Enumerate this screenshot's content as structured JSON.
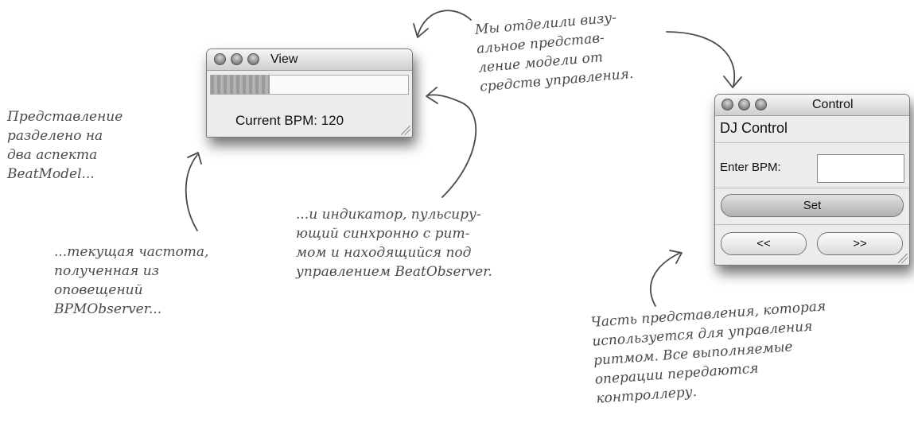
{
  "view_window": {
    "title": "View",
    "bpm_label": "Current BPM: 120",
    "pulse_level": 0.3
  },
  "control_window": {
    "title": "Control",
    "heading": "DJ Control",
    "enter_bpm_label": "Enter BPM:",
    "bpm_input_value": "",
    "set_label": "Set",
    "decrease_label": "<<",
    "increase_label": ">>"
  },
  "annotations": {
    "separated": [
      "Мы отделили визу-",
      "альное представ-",
      "ление модели от",
      "средств управления."
    ],
    "view_split": [
      "Представление",
      "разделено на",
      "два аспекта",
      "BeatModel..."
    ],
    "current_rate": [
      "...текущая частота,",
      "полученная из",
      "оповещений",
      "BPMObserver..."
    ],
    "indicator": [
      "...и индикатор, пульсиру-",
      "ющий синхронно с рит-",
      "мом и находящийся под",
      "управлением BeatObserver."
    ],
    "control_part": [
      "Часть представления, которая",
      "используется для управления",
      "ритмом. Все выполняемые",
      "операции передаются",
      "контроллеру."
    ]
  }
}
